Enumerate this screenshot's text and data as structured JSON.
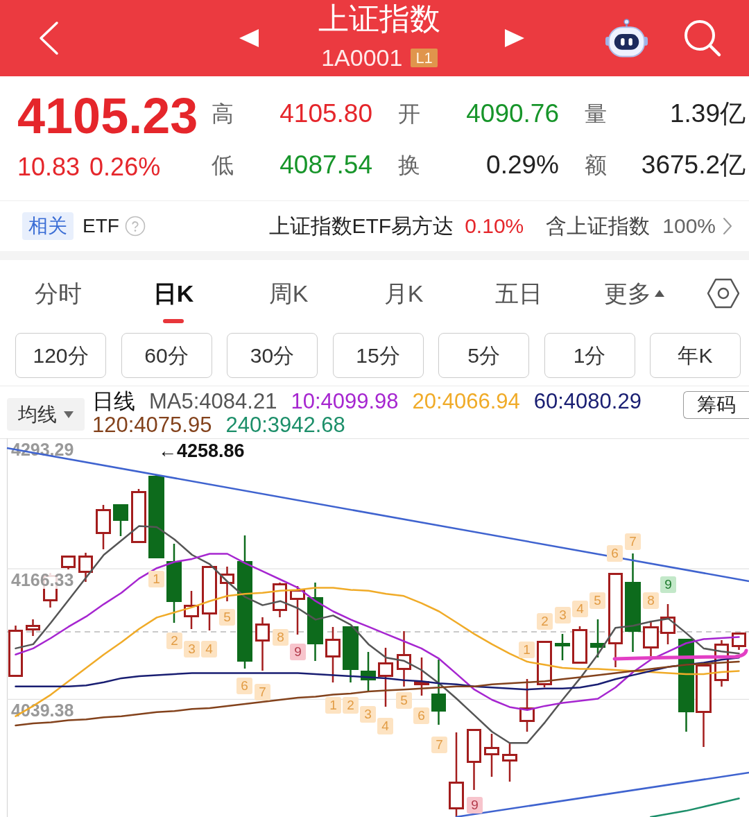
{
  "header": {
    "title": "上证指数",
    "code": "1A0001",
    "level_badge": "L1"
  },
  "quote": {
    "price": "4105.23",
    "change": "10.83",
    "change_percent": "0.26%",
    "color": "#e5262b",
    "stats": [
      {
        "label": "高",
        "value": "4105.80",
        "color": "#e5262b"
      },
      {
        "label": "开",
        "value": "4090.76",
        "color": "#17952a"
      },
      {
        "label": "量",
        "value": "1.39亿",
        "color": "#222222"
      },
      {
        "label": "低",
        "value": "4087.54",
        "color": "#17952a"
      },
      {
        "label": "换",
        "value": "0.29%",
        "color": "#222222"
      },
      {
        "label": "额",
        "value": "3675.2亿",
        "color": "#222222"
      }
    ]
  },
  "etf_bar": {
    "tag": "相关",
    "label": "ETF",
    "fund": "上证指数ETF易方达",
    "fund_change": "0.10%",
    "weight_label": "含上证指数",
    "weight": "100%"
  },
  "period_tabs": [
    {
      "label": "分时",
      "selected": false,
      "kind": "tab"
    },
    {
      "label": "日K",
      "selected": true,
      "kind": "tab"
    },
    {
      "label": "周K",
      "selected": false,
      "kind": "tab"
    },
    {
      "label": "月K",
      "selected": false,
      "kind": "tab"
    },
    {
      "label": "五日",
      "selected": false,
      "kind": "tab"
    },
    {
      "label": "更多",
      "selected": false,
      "kind": "menu"
    }
  ],
  "interval_buttons": [
    {
      "label": "120分",
      "selected": false
    },
    {
      "label": "60分",
      "selected": false
    },
    {
      "label": "30分",
      "selected": false
    },
    {
      "label": "15分",
      "selected": false
    },
    {
      "label": "5分",
      "selected": false
    },
    {
      "label": "1分",
      "selected": false
    },
    {
      "label": "年K",
      "selected": false
    }
  ],
  "ma_legend": {
    "dropdown": "均线",
    "period": "日线",
    "chip_button": "筹码"
  },
  "chart": {
    "chart_data": {
      "type": "line",
      "ylim": [
        3925,
        4293.29
      ],
      "yticks": [
        4039.38,
        4166.33,
        4293.29
      ],
      "series": [
        {
          "name": "MA5:4084.21",
          "color": "#555555",
          "values": [
            4089,
            4093,
            4114,
            4136,
            4158,
            4180,
            4194,
            4208,
            4207,
            4195,
            4180,
            4171,
            4154,
            4139,
            4131,
            4135,
            4128,
            4117,
            4121,
            4112,
            4093,
            4080,
            4077,
            4068,
            4055,
            4040,
            4024,
            4008,
            3997,
            3997,
            4017,
            4039,
            4060,
            4083,
            4109,
            4111,
            4115,
            4118,
            4104,
            4089,
            4086,
            4084
          ]
        },
        {
          "name": "10:4099.98",
          "color": "#a626d0",
          "values": [
            4083,
            4089,
            4099,
            4110,
            4120,
            4132,
            4143,
            4157,
            4167,
            4173,
            4176,
            4181,
            4181,
            4172,
            4164,
            4156,
            4148,
            4135,
            4125,
            4117,
            4110,
            4103,
            4096,
            4089,
            4079,
            4064,
            4049,
            4039,
            4032,
            4029,
            4033,
            4036,
            4038,
            4040,
            4051,
            4066,
            4078,
            4086,
            4094,
            4098,
            4099,
            4100
          ]
        },
        {
          "name": "20:4066.94",
          "color": "#f0ab28",
          "values": [
            4023,
            4033,
            4044,
            4057,
            4070,
            4083,
            4095,
            4108,
            4119,
            4124,
            4129,
            4135,
            4140,
            4142,
            4143,
            4145,
            4146,
            4148,
            4148,
            4146,
            4145,
            4142,
            4140,
            4133,
            4125,
            4114,
            4103,
            4093,
            4084,
            4076,
            4073,
            4070,
            4069,
            4069,
            4068,
            4067,
            4066,
            4065,
            4064,
            4064,
            4066,
            4067
          ]
        },
        {
          "name": "60:4080.29",
          "color": "#191e72",
          "values": [
            4052,
            4052,
            4052,
            4052,
            4053,
            4056,
            4060,
            4062,
            4063,
            4064,
            4065,
            4065,
            4065,
            4065,
            4065,
            4065,
            4065,
            4064,
            4063,
            4062,
            4061,
            4060,
            4058,
            4057,
            4055,
            4054,
            4052,
            4051,
            4050,
            4049,
            4050,
            4050,
            4051,
            4054,
            4059,
            4063,
            4067,
            4071,
            4073,
            4075,
            4078,
            4080
          ]
        },
        {
          "name": "120:4075.95",
          "color": "#83421c",
          "values": [
            4014,
            4016,
            4017,
            4019,
            4020,
            4022,
            4023,
            4025,
            4027,
            4028,
            4030,
            4031,
            4033,
            4035,
            4037,
            4039,
            4041,
            4042,
            4044,
            4045,
            4047,
            4048,
            4049,
            4050,
            4051,
            4052,
            4052,
            4054,
            4055,
            4056,
            4057,
            4059,
            4061,
            4063,
            4065,
            4067,
            4069,
            4071,
            4073,
            4074,
            4075,
            4076
          ]
        },
        {
          "name": "240:3942.68",
          "color": "#1d8f6a",
          "values": [
            null,
            null,
            null,
            null,
            null,
            null,
            null,
            null,
            null,
            null,
            null,
            null,
            null,
            null,
            null,
            null,
            null,
            null,
            null,
            null,
            null,
            null,
            null,
            null,
            null,
            null,
            null,
            null,
            null,
            null,
            null,
            null,
            null,
            null,
            null,
            null,
            3925,
            3928,
            3931,
            3935,
            3939,
            3943
          ]
        }
      ]
    },
    "max_label": "←4258.86",
    "count_tags": [
      {
        "label": "1",
        "kind": "count"
      },
      {
        "label": "2",
        "kind": "count"
      },
      {
        "label": "3",
        "kind": "count"
      },
      {
        "label": "4",
        "kind": "count"
      },
      {
        "label": "5",
        "kind": "count"
      },
      {
        "label": "6",
        "kind": "count"
      },
      {
        "label": "7",
        "kind": "count"
      },
      {
        "label": "8",
        "kind": "count"
      },
      {
        "label": "9",
        "kind": "low_nine"
      },
      {
        "label": "1",
        "kind": "count"
      },
      {
        "label": "2",
        "kind": "count"
      },
      {
        "label": "3",
        "kind": "count"
      },
      {
        "label": "4",
        "kind": "count"
      },
      {
        "label": "5",
        "kind": "count"
      },
      {
        "label": "6",
        "kind": "count"
      },
      {
        "label": "7",
        "kind": "count"
      },
      {
        "label": "9",
        "kind": "low_nine"
      },
      {
        "label": "1",
        "kind": "count"
      },
      {
        "label": "2",
        "kind": "count"
      },
      {
        "label": "3",
        "kind": "count"
      },
      {
        "label": "4",
        "kind": "count"
      },
      {
        "label": "5",
        "kind": "count"
      },
      {
        "label": "6",
        "kind": "count"
      },
      {
        "label": "7",
        "kind": "count"
      },
      {
        "label": "8",
        "kind": "count"
      },
      {
        "label": "9",
        "kind": "high_nine"
      }
    ]
  }
}
